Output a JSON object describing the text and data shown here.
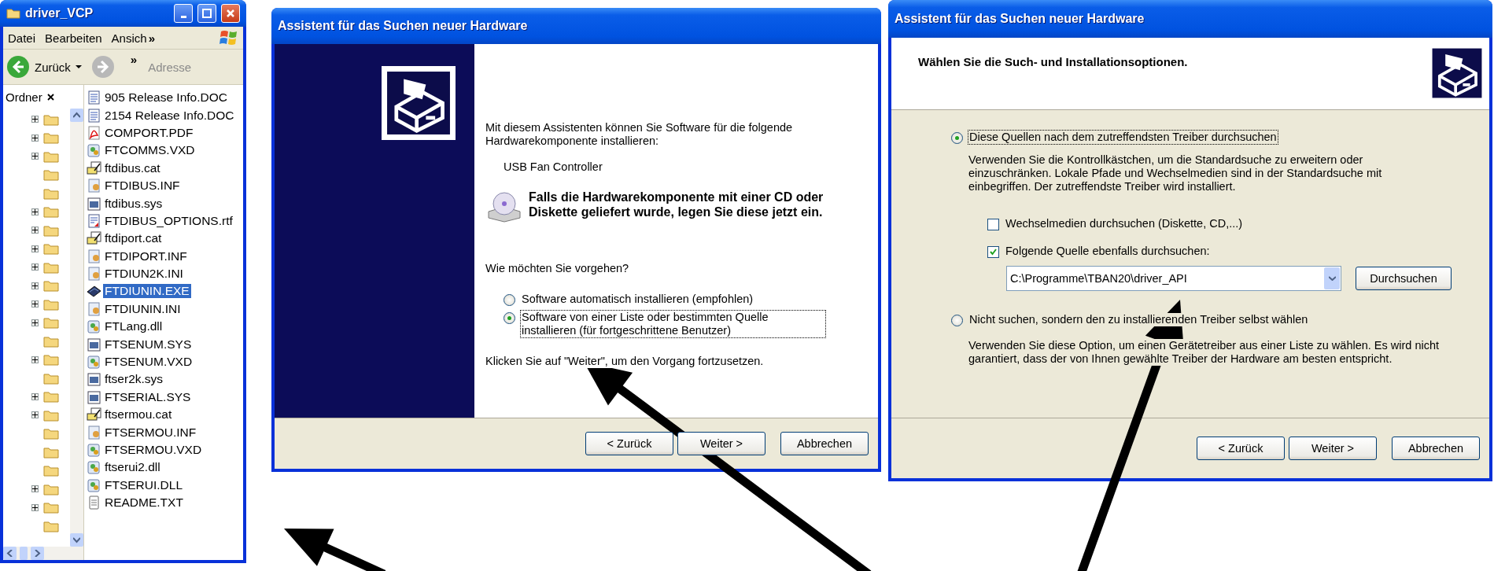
{
  "explorer": {
    "title": "driver_VCP",
    "menu": [
      "Datei",
      "Bearbeiten",
      "Ansich"
    ],
    "menu_more": "»",
    "toolbar": {
      "back": "Zurück",
      "more": "»",
      "address": "Adresse"
    },
    "folders_header": "Ordner",
    "folders": [
      {
        "expandable": true
      },
      {
        "expandable": true
      },
      {
        "expandable": true
      },
      {
        "expandable": false
      },
      {
        "expandable": false
      },
      {
        "expandable": true
      },
      {
        "expandable": true
      },
      {
        "expandable": true
      },
      {
        "expandable": true
      },
      {
        "expandable": true
      },
      {
        "expandable": true
      },
      {
        "expandable": true
      },
      {
        "expandable": false
      },
      {
        "expandable": true
      },
      {
        "expandable": false
      },
      {
        "expandable": true
      },
      {
        "expandable": true
      },
      {
        "expandable": false
      },
      {
        "expandable": false
      },
      {
        "expandable": false
      },
      {
        "expandable": true
      },
      {
        "expandable": true
      },
      {
        "expandable": false
      }
    ],
    "files": [
      {
        "name": "905 Release Info.DOC",
        "kind": "doc",
        "selected": false
      },
      {
        "name": "2154 Release Info.DOC",
        "kind": "doc",
        "selected": false
      },
      {
        "name": "COMPORT.PDF",
        "kind": "pdf",
        "selected": false
      },
      {
        "name": "FTCOMMS.VXD",
        "kind": "component",
        "selected": false
      },
      {
        "name": "ftdibus.cat",
        "kind": "catalog",
        "selected": false
      },
      {
        "name": "FTDIBUS.INF",
        "kind": "setup",
        "selected": false
      },
      {
        "name": "ftdibus.sys",
        "kind": "system",
        "selected": false
      },
      {
        "name": "FTDIBUS_OPTIONS.rtf",
        "kind": "rtf",
        "selected": false
      },
      {
        "name": "ftdiport.cat",
        "kind": "catalog",
        "selected": false
      },
      {
        "name": "FTDIPORT.INF",
        "kind": "setup",
        "selected": false
      },
      {
        "name": "FTDIUN2K.INI",
        "kind": "setup",
        "selected": false
      },
      {
        "name": "FTDIUNIN.EXE",
        "kind": "program",
        "selected": true
      },
      {
        "name": "FTDIUNIN.INI",
        "kind": "setup",
        "selected": false
      },
      {
        "name": "FTLang.dll",
        "kind": "component",
        "selected": false
      },
      {
        "name": "FTSENUM.SYS",
        "kind": "system",
        "selected": false
      },
      {
        "name": "FTSENUM.VXD",
        "kind": "component",
        "selected": false
      },
      {
        "name": "ftser2k.sys",
        "kind": "system",
        "selected": false
      },
      {
        "name": "FTSERIAL.SYS",
        "kind": "system",
        "selected": false
      },
      {
        "name": "ftsermou.cat",
        "kind": "catalog",
        "selected": false
      },
      {
        "name": "FTSERMOU.INF",
        "kind": "setup",
        "selected": false
      },
      {
        "name": "FTSERMOU.VXD",
        "kind": "component",
        "selected": false
      },
      {
        "name": "ftserui2.dll",
        "kind": "component",
        "selected": false
      },
      {
        "name": "FTSERUI.DLL",
        "kind": "component",
        "selected": false
      },
      {
        "name": "README.TXT",
        "kind": "text",
        "selected": false
      }
    ]
  },
  "wizard_start": {
    "title": "Assistent für das Suchen neuer Hardware",
    "intro": "Mit diesem Assistenten können Sie Software für die folgende Hardwarekomponente installieren:",
    "device": "USB Fan Controller",
    "cd_hint": "Falls die Hardwarekomponente mit einer CD oder Diskette geliefert wurde, legen Sie diese jetzt ein.",
    "question": "Wie möchten Sie vorgehen?",
    "options": [
      {
        "label": "Software automatisch installieren (empfohlen)",
        "selected": false
      },
      {
        "label": "Software von einer Liste oder bestimmten Quelle installieren (für fortgeschrittene Benutzer)",
        "selected": true
      }
    ],
    "footer_hint": "Klicken Sie auf \"Weiter\", um den Vorgang fortzusetzen.",
    "buttons": [
      "< Zurück",
      "Weiter >",
      "Abbrechen"
    ]
  },
  "wizard_options": {
    "title": "Assistent für das Suchen neuer Hardware",
    "heading": "Wählen Sie die Such- und Installationsoptionen.",
    "options": [
      {
        "label": "Diese Quellen nach dem zutreffendsten Treiber durchsuchen",
        "selected": true,
        "description": "Verwenden Sie die Kontrollkästchen, um die Standardsuche zu erweitern oder einzuschränken. Lokale Pfade und Wechselmedien sind in der Standardsuche mit einbegriffen. Der zutreffendste Treiber wird installiert.",
        "checks": [
          {
            "label": "Wechselmedien durchsuchen (Diskette, CD,...)",
            "checked": false
          },
          {
            "label": "Folgende Quelle ebenfalls durchsuchen:",
            "checked": true
          }
        ],
        "path": "C:\\Programme\\TBAN20\\driver_API",
        "browse": "Durchsuchen"
      },
      {
        "label": "Nicht suchen, sondern den zu installierenden Treiber selbst wählen",
        "selected": false,
        "description": "Verwenden Sie diese Option, um einen Gerätetreiber aus einer Liste zu wählen. Es wird nicht garantiert, dass der von Ihnen gewählte Treiber der Hardware am besten entspricht."
      }
    ],
    "buttons": [
      "< Zurück",
      "Weiter >",
      "Abbrechen"
    ]
  }
}
